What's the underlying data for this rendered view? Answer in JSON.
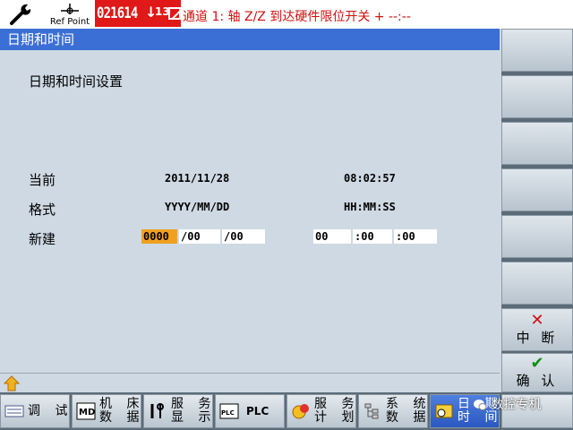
{
  "header": {
    "refpoint_label": "Ref Point",
    "alarm_number": "021614",
    "alarm_count": "13",
    "alarm_message": "通道 1: 轴 Z/Z 到达硬件限位开关 + --:--"
  },
  "title": "日期和时间",
  "main": {
    "heading": "日期和时间设置",
    "rows": [
      {
        "label": "当前",
        "date": "2011/11/28",
        "time": "08:02:57"
      },
      {
        "label": "格式",
        "date": "YYYY/MM/DD",
        "time": "HH:MM:SS"
      },
      {
        "label": "新建"
      }
    ],
    "new_fields": {
      "year": "0000",
      "month": "/00",
      "day": "/00",
      "hour": "00",
      "minute": ":00",
      "second": ":00"
    }
  },
  "softkeys": {
    "cancel_label": "中 断",
    "confirm_label": "确 认",
    "cancel_icon": "red-x",
    "confirm_icon": "green-check"
  },
  "bottom_keys": [
    {
      "label": "调 试"
    },
    {
      "label": "机 床\n数 据"
    },
    {
      "label": "服 务\n显 示"
    },
    {
      "label": "PLC"
    },
    {
      "label": "服 务\n计 划"
    },
    {
      "label": "系 统\n数 据"
    },
    {
      "label": "日 期\n时 间"
    }
  ],
  "watermark": "数控专机",
  "colors": {
    "alarm_bg": "#e01818",
    "title_bg": "#3b6fd6",
    "active_field": "#f0a020",
    "content_bg": "#ced9e3"
  }
}
